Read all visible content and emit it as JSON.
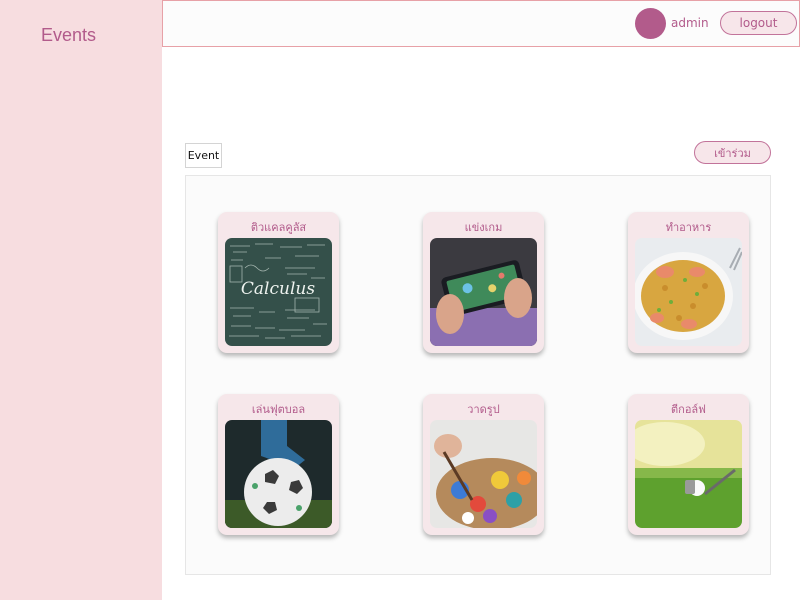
{
  "app": {
    "brand": "Events"
  },
  "header": {
    "user_name": "admin",
    "logout_label": "logout"
  },
  "toolbar": {
    "tab_label": "Event",
    "join_label": "เข้าร่วม"
  },
  "events": [
    {
      "title": "ติวแคลคูลัส",
      "image": "calculus-chalkboard",
      "image_text": "Calculus"
    },
    {
      "title": "แข่งเกม",
      "image": "mobile-gaming"
    },
    {
      "title": "ทำอาหาร",
      "image": "fried-rice"
    },
    {
      "title": "เล่นฟุตบอล",
      "image": "football"
    },
    {
      "title": "วาดรูป",
      "image": "paint-palette"
    },
    {
      "title": "ตีกอล์ฟ",
      "image": "golf-ball"
    }
  ],
  "colors": {
    "accent": "#b25b8b",
    "sidebar": "#f7dde0",
    "card": "#f6e7ea",
    "header_border": "#e7a1a7"
  }
}
